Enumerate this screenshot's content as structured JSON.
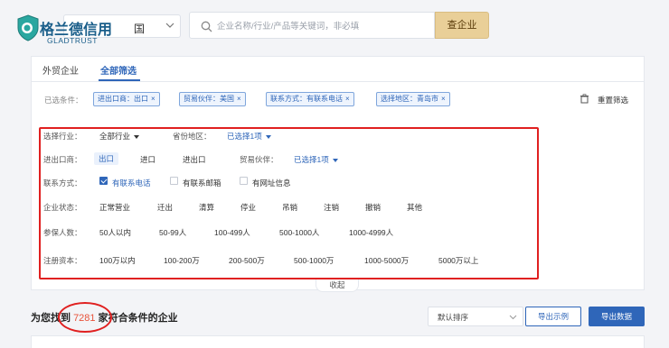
{
  "header": {
    "brand_cn": "格兰德信用",
    "brand_suffix": "国",
    "brand_en": "GLADTRUST",
    "search_placeholder": "企业名称/行业/产品等关键词，非必填",
    "search_button": "查企业"
  },
  "tabs": [
    {
      "label": "外贸企业",
      "active": false
    },
    {
      "label": "全部筛选",
      "active": true
    }
  ],
  "selected": {
    "label": "已选条件：",
    "chips": [
      "进出口商：出口",
      "贸易伙伴：美国",
      "联系方式：有联系电话",
      "选择地区：青岛市"
    ],
    "clear_label": "重置筛选"
  },
  "filters": {
    "industry_label": "选择行业：",
    "industry_value": "全部行业",
    "province_label": "省份地区：",
    "province_value": "已选择1项",
    "importer_label": "进出口商：",
    "importer_options": [
      "出口",
      "进口",
      "进出口"
    ],
    "partner_label": "贸易伙伴：",
    "partner_value": "已选择1项",
    "contact_label": "联系方式：",
    "contact_options": [
      {
        "label": "有联系电话",
        "checked": true
      },
      {
        "label": "有联系邮箱",
        "checked": false
      },
      {
        "label": "有网址信息",
        "checked": false
      }
    ],
    "status_label": "企业状态：",
    "status_options": [
      "正常营业",
      "迁出",
      "清算",
      "停业",
      "吊销",
      "注销",
      "撤销",
      "其他"
    ],
    "insured_label": "参保人数：",
    "insured_options": [
      "50人以内",
      "50-99人",
      "100-499人",
      "500-1000人",
      "1000-4999人"
    ],
    "capital_label": "注册资本：",
    "capital_options": [
      "100万以内",
      "100-200万",
      "200-500万",
      "500-1000万",
      "1000-5000万",
      "5000万以上"
    ],
    "collapse_label": "收起"
  },
  "result": {
    "prefix": "为您找到",
    "count": "7281",
    "suffix": "家符合条件的企业",
    "sort_value": "默认排序",
    "example_button": "导出示例",
    "export_button": "导出数据"
  },
  "colors": {
    "accent": "#2f66b9",
    "highlight": "#e02020",
    "search_button": "#e9cf98"
  }
}
